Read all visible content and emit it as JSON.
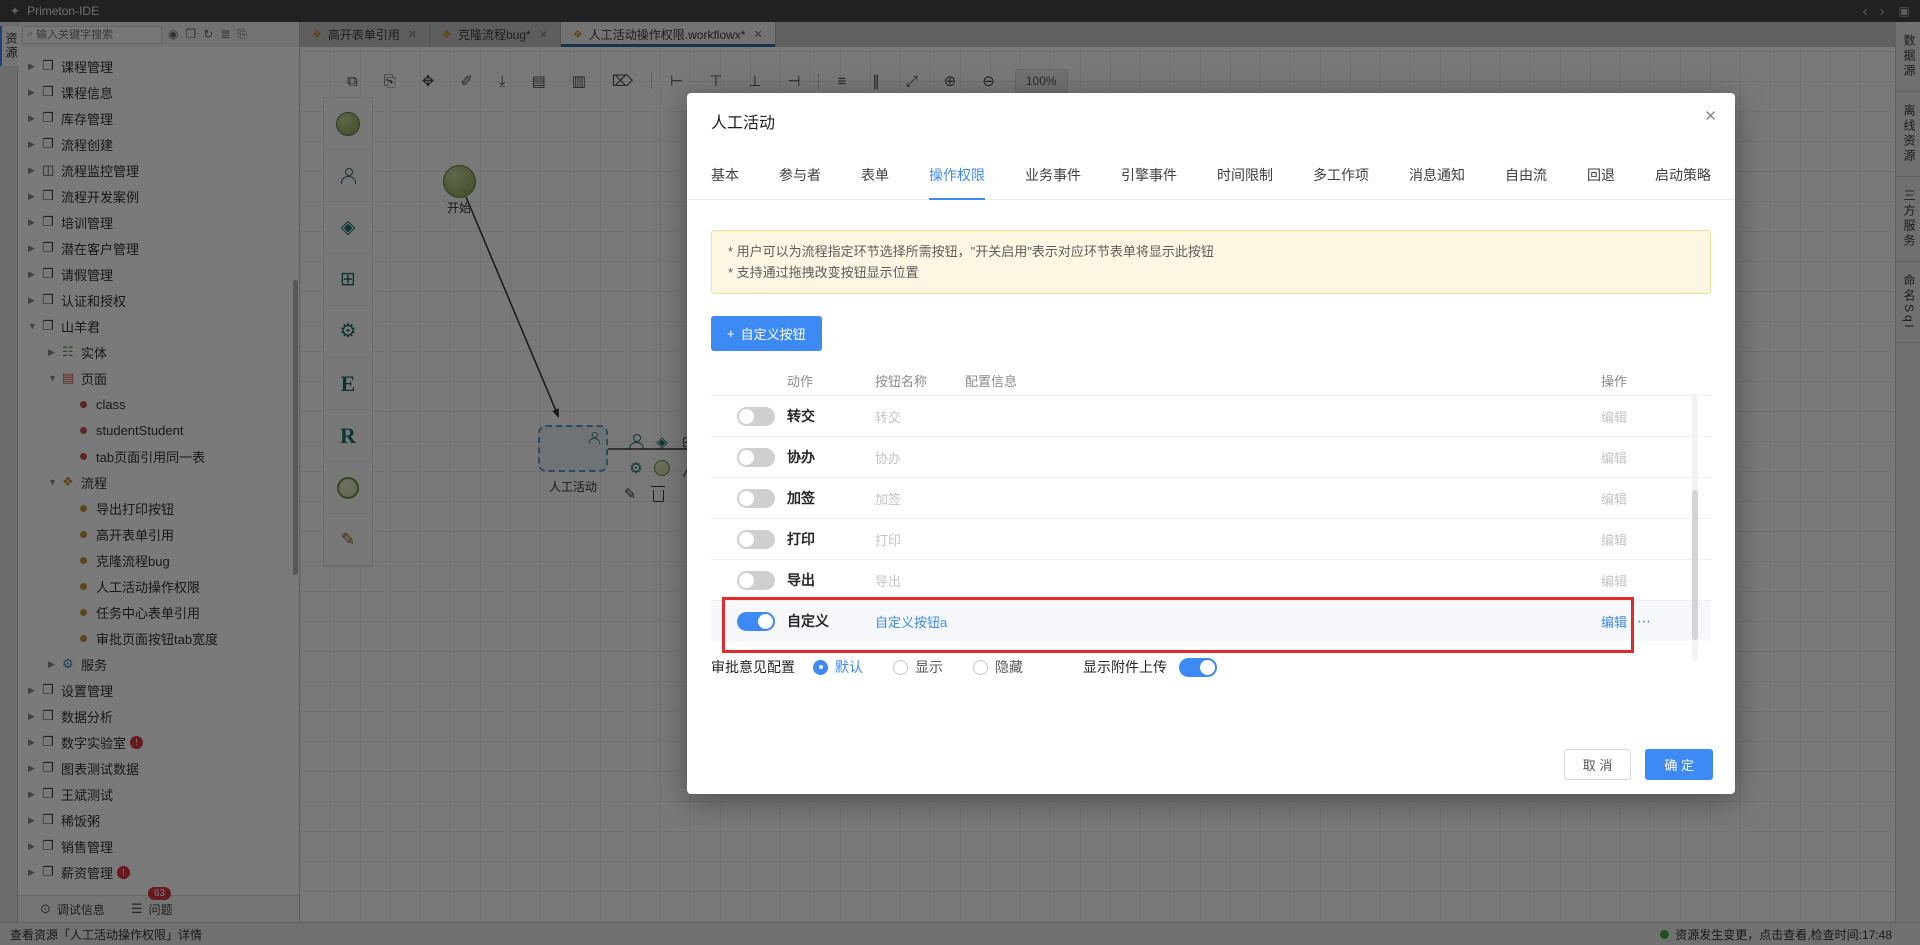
{
  "app": {
    "title": "Primeton-IDE"
  },
  "colors": {
    "accent": "#3D8AF5",
    "annotation": "#E02B2B",
    "success": "#3FAE3F",
    "notice_bg": "#FDF6E2",
    "notice_border": "#F5E0A3"
  },
  "icons": {
    "logo": "✦",
    "back": "‹",
    "forward": "›",
    "save": "▣",
    "search": "⌕",
    "ai": "◉",
    "package_small": "❒",
    "refresh": "↻",
    "sort": "≣",
    "docs": "⎘",
    "close": "✕",
    "collapsed": "▶",
    "expanded": "▼",
    "package": "❒",
    "monitor": "◫",
    "database": "☷",
    "page": "▤",
    "workflow": "❖",
    "gear": "⚙",
    "warning": "!",
    "bug": "⊙",
    "list": "☰",
    "gateway": "◈",
    "subprocess": "⊞",
    "entity": "E",
    "report": "R",
    "note": "✎",
    "edit": "✎",
    "connector": "╱",
    "more": "⋯",
    "plus": "+"
  },
  "left_rail": {
    "tab": "资源"
  },
  "explorer": {
    "search_placeholder": "输入关键字搜索",
    "tree": [
      {
        "label": "课程管理"
      },
      {
        "label": "课程信息"
      },
      {
        "label": "库存管理"
      },
      {
        "label": "流程创建"
      },
      {
        "label": "流程监控管理"
      },
      {
        "label": "流程开发案例"
      },
      {
        "label": "培训管理"
      },
      {
        "label": "潜在客户管理"
      },
      {
        "label": "请假管理"
      },
      {
        "label": "认证和授权"
      },
      {
        "label": "山羊君"
      },
      {
        "label": "实体"
      },
      {
        "label": "页面"
      },
      {
        "label": "class"
      },
      {
        "label": "studentStudent"
      },
      {
        "label": "tab页面引用同一表"
      },
      {
        "label": "流程"
      },
      {
        "label": "导出打印按钮"
      },
      {
        "label": "高开表单引用"
      },
      {
        "label": "克隆流程bug"
      },
      {
        "label": "人工活动操作权限"
      },
      {
        "label": "任务中心表单引用"
      },
      {
        "label": "审批页面按钮tab宽度"
      },
      {
        "label": "服务"
      },
      {
        "label": "设置管理"
      },
      {
        "label": "数据分析"
      },
      {
        "label": "数字实验室",
        "badge": "!"
      },
      {
        "label": "图表测试数据"
      },
      {
        "label": "王斌测试"
      },
      {
        "label": "稀饭粥"
      },
      {
        "label": "销售管理"
      },
      {
        "label": "薪资管理",
        "badge": "!"
      }
    ],
    "debug_label": "调试信息",
    "problems_label": "问题",
    "problems_count": "63"
  },
  "doc_tabs": [
    {
      "label": "高开表单引用"
    },
    {
      "label": "克隆流程bug*"
    },
    {
      "label": "人工活动操作权限.workflowx*",
      "active": true
    }
  ],
  "canvas": {
    "toolbar": [
      {
        "name": "copy",
        "glyph": "⧉"
      },
      {
        "name": "paste",
        "glyph": "⎘"
      },
      {
        "name": "pan",
        "glyph": "✥"
      },
      {
        "name": "brush",
        "glyph": "✐"
      },
      {
        "name": "download",
        "glyph": "⤓"
      },
      {
        "name": "document",
        "glyph": "▤"
      },
      {
        "name": "duplicate",
        "glyph": "▥"
      },
      {
        "name": "delete",
        "glyph": "⌦"
      },
      {
        "name": "align-left",
        "glyph": "⊢"
      },
      {
        "name": "align-top",
        "glyph": "⊤"
      },
      {
        "name": "align-bottom",
        "glyph": "⊥"
      },
      {
        "name": "align-right",
        "glyph": "⊣"
      },
      {
        "name": "distribute-h",
        "glyph": "≡"
      },
      {
        "name": "chart",
        "glyph": "∥"
      },
      {
        "name": "fit-screen",
        "glyph": "⤢"
      },
      {
        "name": "zoom-in",
        "glyph": "⊕"
      },
      {
        "name": "zoom-out",
        "glyph": "⊖"
      }
    ],
    "zoom_level": "100%",
    "palette": [
      {
        "name": "start-node",
        "glyph": ""
      },
      {
        "name": "manual-activity",
        "glyph": ""
      },
      {
        "name": "gateway",
        "glyph": "◈"
      },
      {
        "name": "subprocess",
        "glyph": "⊞"
      },
      {
        "name": "auto-activity",
        "glyph": "⚙"
      },
      {
        "name": "entity",
        "glyph": "E"
      },
      {
        "name": "report",
        "glyph": "R"
      },
      {
        "name": "end-node",
        "glyph": ""
      },
      {
        "name": "note",
        "glyph": "✎"
      }
    ],
    "nodes": {
      "start_label": "开始",
      "activity_label": "人工活动"
    }
  },
  "right_rail": {
    "tabs": [
      "数据源",
      "离线资源",
      "三方服务",
      "命名Sql"
    ]
  },
  "status_bar": {
    "left": "查看资源「人工活动操作权限」详情",
    "right": "资源发生变更，点击查看,检查时间:17:48"
  },
  "dialog": {
    "title": "人工活动",
    "tabs": [
      {
        "label": "基本"
      },
      {
        "label": "参与者"
      },
      {
        "label": "表单"
      },
      {
        "label": "操作权限",
        "active": true
      },
      {
        "label": "业务事件"
      },
      {
        "label": "引擎事件"
      },
      {
        "label": "时间限制"
      },
      {
        "label": "多工作项"
      },
      {
        "label": "消息通知"
      },
      {
        "label": "自由流"
      },
      {
        "label": "回退"
      },
      {
        "label": "启动策略"
      }
    ],
    "notice": {
      "line1": "* 用户可以为流程指定环节选择所需按钮，\"开关启用\"表示对应环节表单将显示此按钮",
      "line2": "* 支持通过拖拽改变按钮显示位置"
    },
    "add_button_label": "自定义按钮",
    "table": {
      "headers": [
        "动作",
        "按钮名称",
        "配置信息",
        "操作"
      ],
      "rows": [
        {
          "action": "转交",
          "name": "转交",
          "enabled": false,
          "op": "编辑"
        },
        {
          "action": "协办",
          "name": "协办",
          "enabled": false,
          "op": "编辑"
        },
        {
          "action": "加签",
          "name": "加签",
          "enabled": false,
          "op": "编辑"
        },
        {
          "action": "打印",
          "name": "打印",
          "enabled": false,
          "op": "编辑"
        },
        {
          "action": "导出",
          "name": "导出",
          "enabled": false,
          "op": "编辑"
        },
        {
          "action": "自定义",
          "name": "自定义按钮a",
          "enabled": true,
          "op": "编辑",
          "highlighted": true
        }
      ]
    },
    "opinion": {
      "label": "审批意见配置",
      "options": [
        "默认",
        "显示",
        "隐藏"
      ],
      "selected": "默认"
    },
    "attachment": {
      "label": "显示附件上传",
      "enabled": true
    },
    "footer": {
      "cancel": "取 消",
      "ok": "确 定"
    }
  }
}
